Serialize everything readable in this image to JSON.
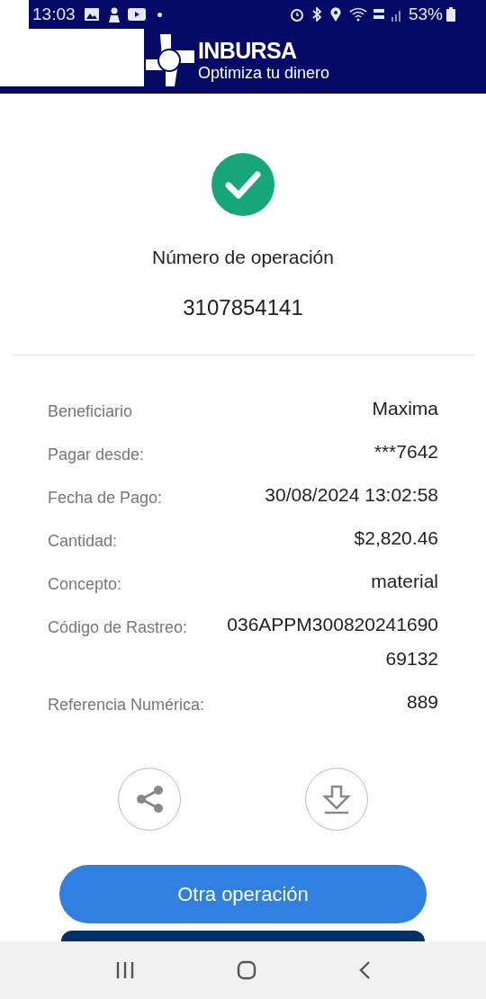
{
  "status_bar": {
    "time": "13:03",
    "battery": "53%"
  },
  "header": {
    "brand": "INBURSA",
    "tagline": "Optimiza tu dinero"
  },
  "result": {
    "kind": "success",
    "label": "Número de operación",
    "number": "3107854141"
  },
  "details": [
    {
      "label": "Beneficiario",
      "value": "Maxima"
    },
    {
      "label": "Pagar desde:",
      "value": "***7642"
    },
    {
      "label": "Fecha de Pago:",
      "value": "30/08/2024 13:02:58"
    },
    {
      "label": "Cantidad:",
      "value": "$2,820.46"
    },
    {
      "label": "Concepto:",
      "value": "material"
    },
    {
      "label": "Código de Rastreo:",
      "value": "036APPM30082024169069132"
    },
    {
      "label": "Referencia Numérica:",
      "value": "889"
    }
  ],
  "actions": [
    {
      "kind": "share"
    },
    {
      "kind": "download"
    }
  ],
  "buttons": [
    {
      "label": "Otra operación",
      "kind": "primary"
    }
  ]
}
